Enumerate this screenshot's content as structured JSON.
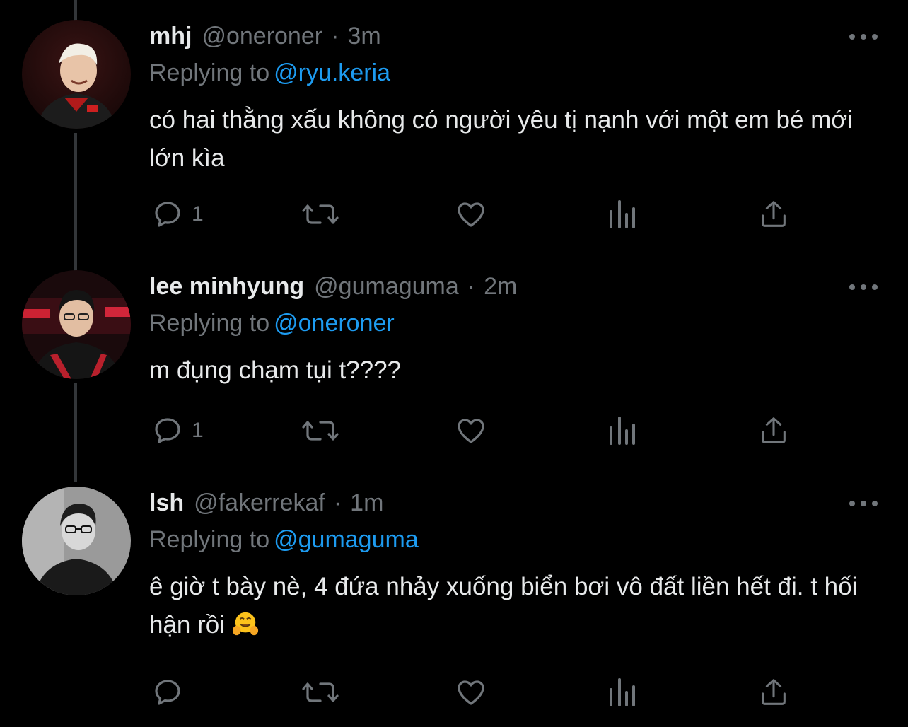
{
  "colors": {
    "background": "#000000",
    "primary_text": "#e7e9ea",
    "secondary_text": "#71767b",
    "accent": "#1d9bf0",
    "thread_line": "#333639"
  },
  "tweets": [
    {
      "name": "mhj",
      "handle": "@oneroner",
      "separator": "·",
      "time": "3m",
      "replying_prefix": "Replying to",
      "replying_to": "@ryu.keria",
      "text": "có hai thằng xấu không có người yêu tị nạnh với một em bé mới lớn kìa",
      "reply_count": "1",
      "avatar_icon": "avatar-photo"
    },
    {
      "name": "lee minhyung",
      "handle": "@gumaguma",
      "separator": "·",
      "time": "2m",
      "replying_prefix": "Replying to",
      "replying_to": "@oneroner",
      "text": "m đụng chạm tụi t????",
      "reply_count": "1",
      "avatar_icon": "avatar-photo"
    },
    {
      "name": "lsh",
      "handle": "@fakerrekaf",
      "separator": "·",
      "time": "1m",
      "replying_prefix": "Replying to",
      "replying_to": "@gumaguma",
      "text": "ê giờ t bày nè, 4 đứa nhảy xuống biển bơi vô đất liền hết đi. t hối hận rồi",
      "text_emoji": "hugging-face",
      "reply_count": "",
      "avatar_icon": "avatar-photo"
    }
  ],
  "action_icons": [
    "reply-icon",
    "retweet-icon",
    "like-icon",
    "analytics-icon",
    "share-icon"
  ]
}
